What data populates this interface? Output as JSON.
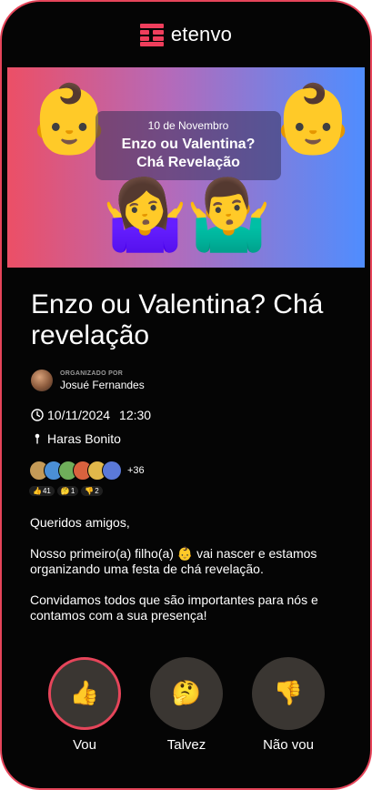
{
  "brand": {
    "name": "etenvo",
    "accent": "#ef3e5c"
  },
  "banner": {
    "date": "10 de Novembro",
    "title_line1": "Enzo ou Valentina?",
    "title_line2": "Chá Revelação",
    "emojis": {
      "baby": "👶",
      "woman_shrug": "🤷‍♀️",
      "man_shrug": "🤷‍♂️"
    }
  },
  "event": {
    "title": "Enzo ou Valentina? Chá revelação",
    "organizer_label": "ORGANIZADO POR",
    "organizer_name": "Josué Fernandes",
    "date": "10/11/2024",
    "time": "12:30",
    "location": "Haras Bonito",
    "attendees_more": "+36",
    "reactions": {
      "yes": "41",
      "maybe": "1",
      "no": "2"
    }
  },
  "description": {
    "p1": "Queridos amigos,",
    "p2": "Nosso primeiro(a) filho(a) 👶 vai nascer e estamos organizando uma festa de chá revelação.",
    "p3": "Convidamos todos que são importantes para nós e contamos com a sua presença!"
  },
  "rsvp": {
    "yes_label": "Vou",
    "maybe_label": "Talvez",
    "no_label": "Não vou",
    "selected": "yes"
  }
}
